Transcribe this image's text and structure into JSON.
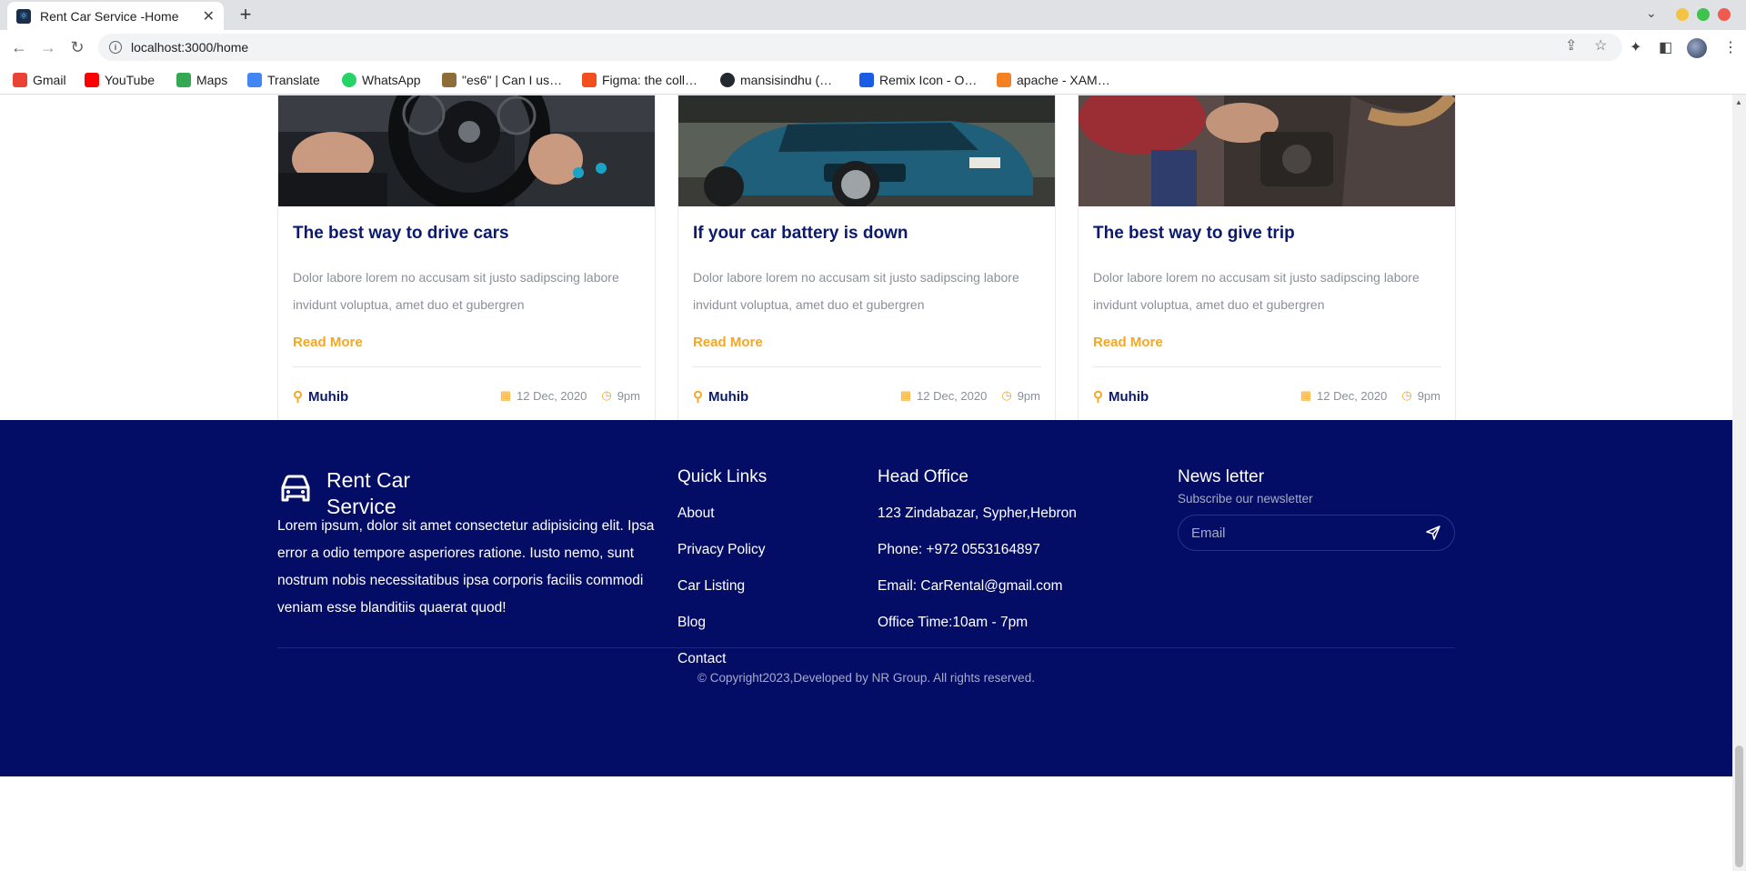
{
  "browser": {
    "tab_title": "Rent Car Service -Home",
    "new_tab": "+",
    "url": "localhost:3000/home",
    "bookmarks": [
      {
        "label": "Gmail",
        "color": "#ea4335"
      },
      {
        "label": "YouTube",
        "color": "#ff0000"
      },
      {
        "label": "Maps",
        "color": "#34a853"
      },
      {
        "label": "Translate",
        "color": "#4285f4"
      },
      {
        "label": "WhatsApp",
        "color": "#25d366"
      },
      {
        "label": "\"es6\" | Can I us…",
        "color": "#8e6d3b"
      },
      {
        "label": "Figma: the coll…",
        "color": "#f24e1e"
      },
      {
        "label": "mansisindhu (…",
        "color": "#24292e"
      },
      {
        "label": "Remix Icon - O…",
        "color": "#1a5ce6"
      },
      {
        "label": "apache - XAM…",
        "color": "#f48024"
      }
    ],
    "window_colors": [
      "#f5c344",
      "#3fc24e",
      "#ef5b4f"
    ]
  },
  "blog": {
    "cards": [
      {
        "title": "The best way to drive cars",
        "description": "Dolor labore lorem no accusam sit justo sadipscing labore invidunt voluptua, amet duo et gubergren",
        "read_more": "Read More",
        "author": "Muhib",
        "date": "12 Dec, 2020",
        "time": "9pm"
      },
      {
        "title": "If your car battery is down",
        "description": "Dolor labore lorem no accusam sit justo sadipscing labore invidunt voluptua, amet duo et gubergren",
        "read_more": "Read More",
        "author": "Muhib",
        "date": "12 Dec, 2020",
        "time": "9pm"
      },
      {
        "title": "The best way to give trip",
        "description": "Dolor labore lorem no accusam sit justo sadipscing labore invidunt voluptua, amet duo et gubergren",
        "read_more": "Read More",
        "author": "Muhib",
        "date": "12 Dec, 2020",
        "time": "9pm"
      }
    ]
  },
  "footer": {
    "brand_name": "Rent Car Service",
    "about": "Lorem ipsum, dolor sit amet consectetur adipisicing elit. Ipsa error a odio tempore asperiores ratione. Iusto nemo, sunt nostrum nobis necessitatibus ipsa corporis facilis commodi veniam esse blanditiis quaerat quod!",
    "quick_links_title": "Quick Links",
    "quick_links": [
      "About",
      "Privacy Policy",
      "Car Listing",
      "Blog",
      "Contact"
    ],
    "head_office_title": "Head Office",
    "address": "123 Zindabazar, Sypher,Hebron",
    "phone": "Phone: +972 0553164897",
    "email": "Email: CarRental@gmail.com",
    "office_time": "Office Time:10am - 7pm",
    "newsletter_title": "News letter",
    "newsletter_subtitle": "Subscribe our newsletter",
    "email_placeholder": "Email",
    "copyright": "Copyright2023,Developed by NR Group. All rights reserved."
  },
  "colors": {
    "footer_bg": "#040d66",
    "accent": "#f5a623",
    "title_navy": "#0b1a6b"
  }
}
